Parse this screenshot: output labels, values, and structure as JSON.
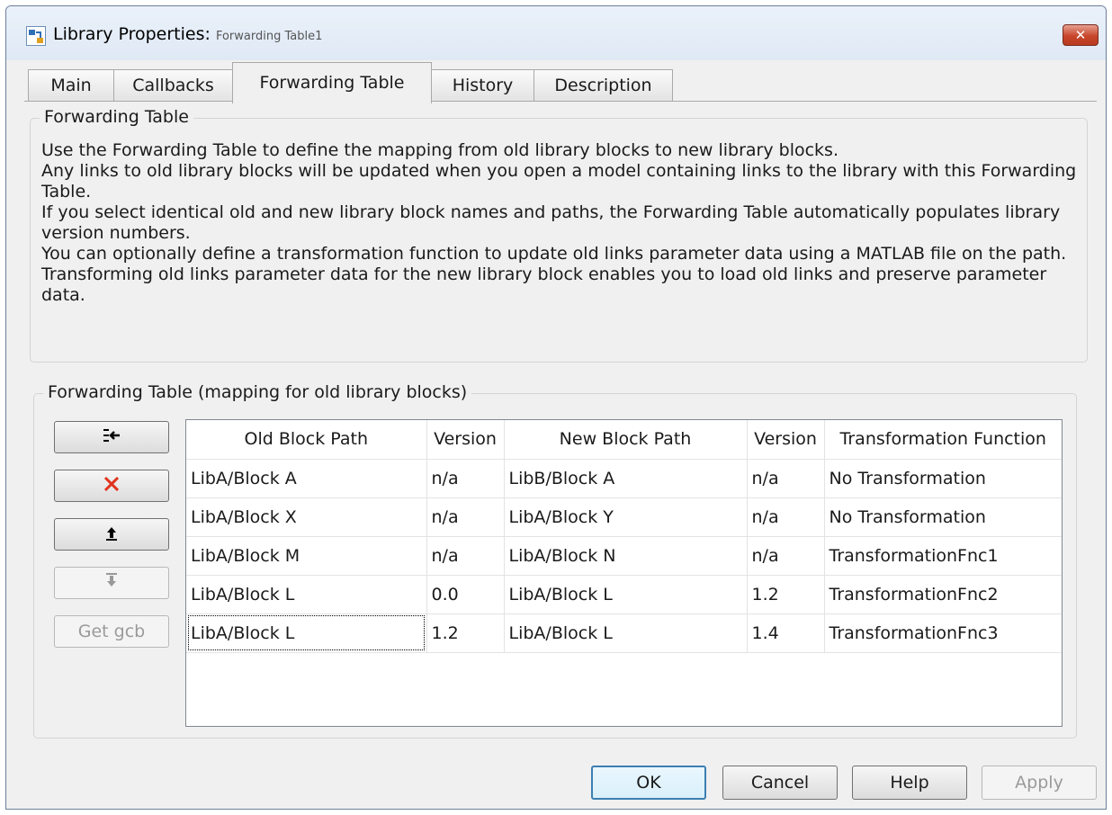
{
  "window": {
    "title": "Library Properties: ",
    "subtitle": "Forwarding Table1",
    "close_label": "✕"
  },
  "tabs": [
    {
      "label": "Main"
    },
    {
      "label": "Callbacks"
    },
    {
      "label": "Forwarding Table",
      "active": true
    },
    {
      "label": "History"
    },
    {
      "label": "Description"
    }
  ],
  "info_group": {
    "title": "Forwarding Table",
    "lines": [
      "Use the Forwarding Table to define the mapping from old library blocks to new library blocks.",
      "Any links to old library blocks will be updated when you open a model containing links to the library with this Forwarding Table.",
      "If you select identical old and new library block names and paths, the Forwarding Table automatically populates library version numbers.",
      "You can optionally define a transformation function to update old links parameter data using a MATLAB file on the path. Transforming old links parameter data for the new library block enables you to load old links and preserve parameter data."
    ]
  },
  "table_group": {
    "title": "Forwarding Table (mapping for old library blocks)",
    "side_buttons": {
      "get_gcb_label": "Get gcb"
    },
    "columns": [
      "Old Block Path",
      "Version",
      "New Block Path",
      "Version",
      "Transformation Function"
    ],
    "rows": [
      [
        "LibA/Block A",
        "n/a",
        "LibB/Block A",
        "n/a",
        "No Transformation"
      ],
      [
        "LibA/Block X",
        "n/a",
        "LibA/Block Y",
        "n/a",
        "No Transformation"
      ],
      [
        "LibA/Block M",
        "n/a",
        "LibA/Block N",
        "n/a",
        "TransformationFnc1"
      ],
      [
        "LibA/Block L",
        "0.0",
        "LibA/Block L",
        "1.2",
        "TransformationFnc2"
      ],
      [
        "LibA/Block L",
        "1.2",
        "LibA/Block L",
        "1.4",
        "TransformationFnc3"
      ]
    ]
  },
  "buttons": {
    "ok": "OK",
    "cancel": "Cancel",
    "help": "Help",
    "apply": "Apply"
  }
}
